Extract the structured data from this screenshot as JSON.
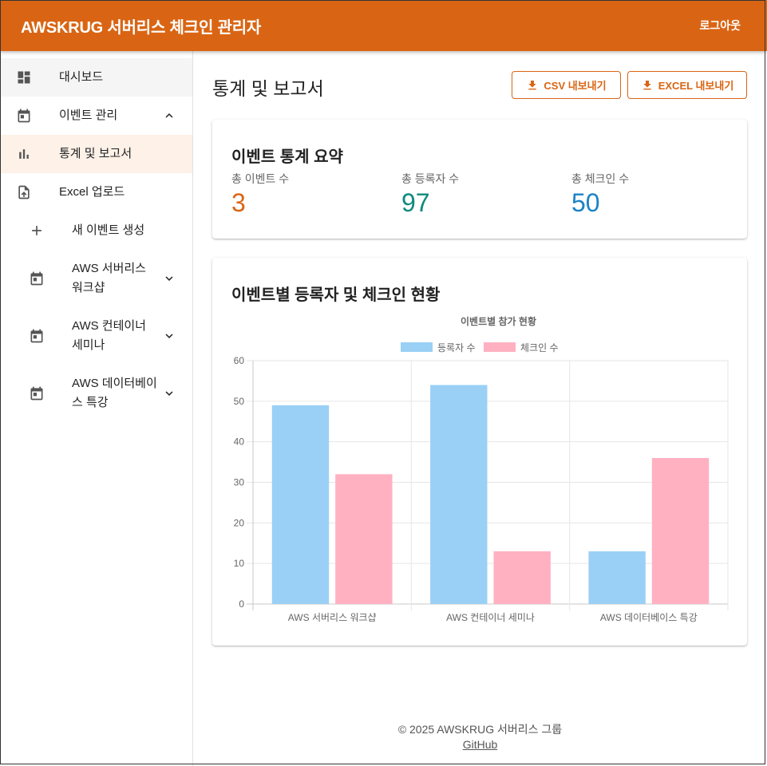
{
  "app": {
    "title": "AWSKRUG 서버리스 체크인 관리자",
    "logout_label": "로그아웃"
  },
  "colors": {
    "primary": "#d96514",
    "registered": "#9ad0f5",
    "checked_in": "#ffb1c1",
    "stat_events": "#d96514",
    "stat_registrants": "#0f8a7e",
    "stat_checkins": "#1a83c6"
  },
  "sidebar": {
    "items": [
      {
        "label": "대시보드",
        "icon": "dashboard-icon"
      },
      {
        "label": "이벤트 관리",
        "icon": "calendar-icon",
        "expanded": true
      },
      {
        "label": "통계 및 보고서",
        "icon": "bar-chart-icon",
        "active": true
      },
      {
        "label": "Excel 업로드",
        "icon": "upload-file-icon"
      },
      {
        "label": "새 이벤트 생성",
        "icon": "plus-icon"
      },
      {
        "label_lines": [
          "AWS 서버리스",
          "워크샵"
        ],
        "icon": "calendar-icon"
      },
      {
        "label_lines": [
          "AWS 컨테이너",
          "세미나"
        ],
        "icon": "calendar-icon"
      },
      {
        "label_lines": [
          "AWS 데이터베이",
          "스 특강"
        ],
        "icon": "calendar-icon"
      }
    ]
  },
  "page": {
    "title": "통계 및 보고서",
    "csv_button": "CSV 내보내기",
    "excel_button": "EXCEL 내보내기"
  },
  "summary": {
    "title": "이벤트 통계 요약",
    "stats": [
      {
        "label": "총 이벤트 수",
        "value": "3"
      },
      {
        "label": "총 등록자 수",
        "value": "97"
      },
      {
        "label": "총 체크인 수",
        "value": "50"
      }
    ]
  },
  "chart_card": {
    "title": "이벤트별 등록자 및 체크인 현황"
  },
  "chart_data": {
    "type": "bar",
    "title": "이벤트별 참가 현황",
    "categories": [
      "AWS 서버리스 워크샵",
      "AWS 컨테이너 세미나",
      "AWS 데이터베이스 특강"
    ],
    "series": [
      {
        "name": "등록자 수",
        "values": [
          49,
          54,
          13
        ],
        "color": "#9ad0f5"
      },
      {
        "name": "체크인 수",
        "values": [
          32,
          13,
          36
        ],
        "color": "#ffb1c1"
      }
    ],
    "yticks": [
      "0",
      "10",
      "20",
      "30",
      "40",
      "50",
      "60"
    ],
    "ylim": [
      0,
      60
    ],
    "legend": "top",
    "grid": true
  },
  "footer": {
    "copyright": "© 2025 AWSKRUG 서버리스 그룹",
    "link": "GitHub"
  }
}
